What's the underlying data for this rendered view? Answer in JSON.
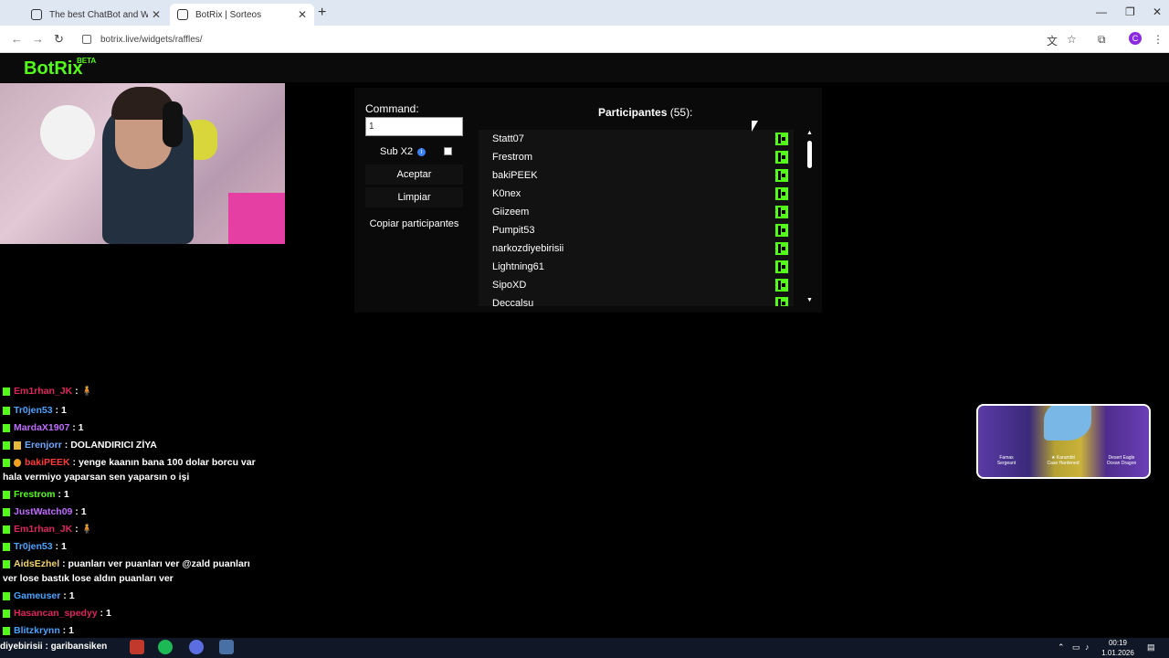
{
  "browser": {
    "tabs": [
      {
        "title": "The best ChatBot and Widgets",
        "active": false
      },
      {
        "title": "BotRix | Sorteos",
        "active": true
      }
    ],
    "url": "botrix.live/widgets/raffles/",
    "profile_initial": "C"
  },
  "site": {
    "logo": "BotRix",
    "beta": "BETA"
  },
  "raffle": {
    "command_label": "Command:",
    "command_value": "1",
    "sub_label": "Sub X2",
    "buttons": {
      "accept": "Aceptar",
      "clear": "Limpiar",
      "copy": "Copiar participantes"
    },
    "participants_label": "Participantes",
    "participants_count": "(55):",
    "participants": [
      "Statt07",
      "Frestrom",
      "bakiPEEK",
      "K0nex",
      "Giizeem",
      "Pumpit53",
      "narkozdiyebirisii",
      "Lightning61",
      "SipoXD",
      "Deccalsu"
    ]
  },
  "chat": [
    {
      "user": "Em1rhan_JK",
      "text": " : ",
      "color": "#e0245e"
    },
    {
      "user": "Tr0jen53",
      "text": " : 1",
      "color": "#4aa3ff"
    },
    {
      "user": "MardaX1907",
      "text": " : 1",
      "color": "#c06bff"
    },
    {
      "user": "Erenjorr",
      "text": " : DOLANDIRICI ZİYA",
      "color": "#6fa8ff"
    },
    {
      "user": "bakiPEEK",
      "text": " : yenge kaanın bana 100 dolar borcu var hala vermiyo yaparsan sen yaparsın o işi",
      "color": "#ff3b3b"
    },
    {
      "user": "Frestrom",
      "text": " : 1",
      "color": "#53fc18"
    },
    {
      "user": "JustWatch09",
      "text": " : 1",
      "color": "#c06bff"
    },
    {
      "user": "Em1rhan_JK",
      "text": " : ",
      "color": "#e0245e"
    },
    {
      "user": "Tr0jen53",
      "text": " : 1",
      "color": "#4aa3ff"
    },
    {
      "user": "AidsEzhel",
      "text": " : puanları ver puanları ver @zald puanları ver lose bastık lose aldın puanları ver",
      "color": "#f3d36b"
    },
    {
      "user": "Gameuser",
      "text": " : 1",
      "color": "#4aa3ff"
    },
    {
      "user": "Hasancan_spedyy",
      "text": " : 1",
      "color": "#e0245e"
    },
    {
      "user": "Blitzkrynn",
      "text": " : 1",
      "color": "#4aa3ff"
    }
  ],
  "skins": {
    "left": {
      "name": "Famas",
      "sub": "Sergeant"
    },
    "center": {
      "name": "★ Karambit",
      "sub": "Case Hardened"
    },
    "right": {
      "name": "Desert Eagle",
      "sub": "Ocean Dragon"
    }
  },
  "taskbar": {
    "ticker": "diyebirisii : garibansiken",
    "time": "00:19",
    "date": "1.01.2026"
  }
}
